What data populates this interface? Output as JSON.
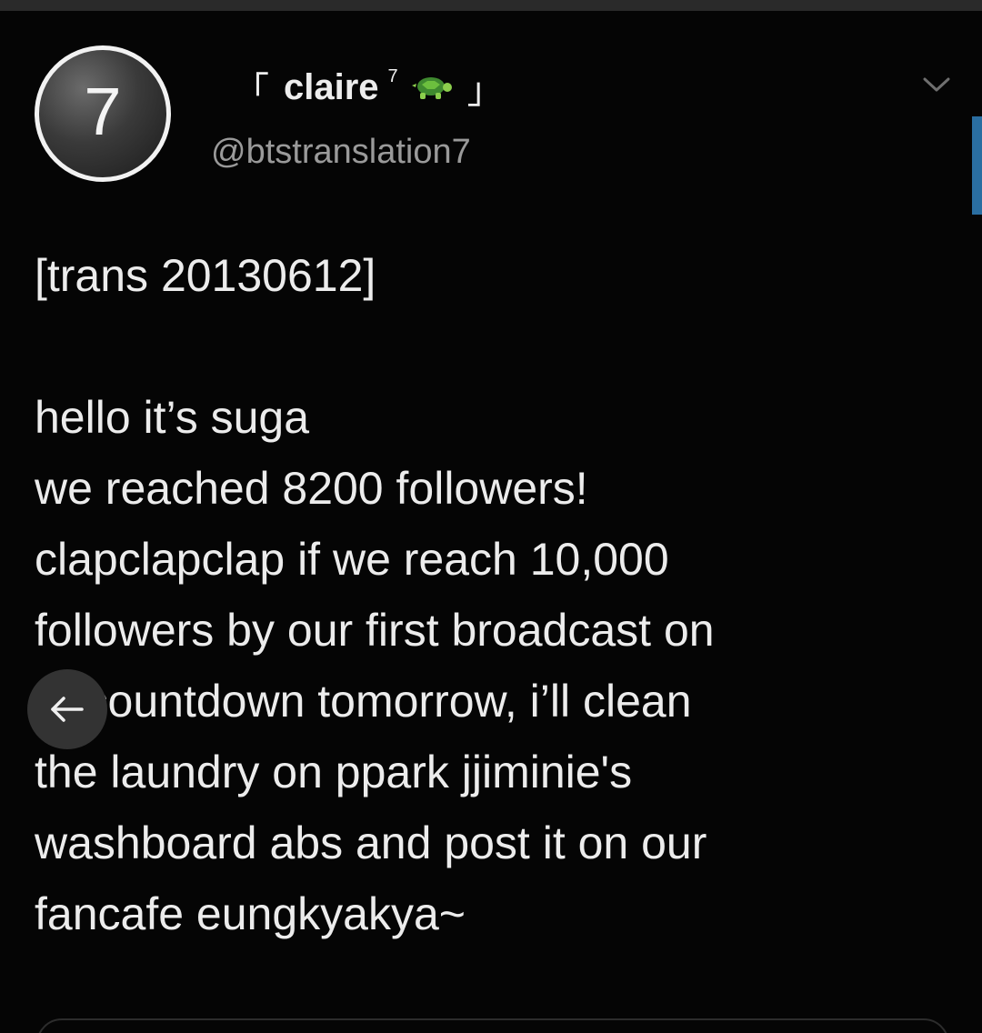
{
  "tweet": {
    "avatar_text": "7",
    "display_name": {
      "open_bracket": "「",
      "name": "claire",
      "superscript": "7",
      "close_bracket": "」"
    },
    "handle": "@btstranslation7",
    "text_lines": [
      "[trans 20130612]",
      "",
      "hello it’s suga",
      "we reached 8200 followers!",
      "clapclapclap if we reach 10,000",
      "followers by our first broadcast on",
      "m countdown tomorrow, i’ll clean",
      "the laundry on ppark jjiminie's",
      "washboard abs and post it on our",
      "fancafe eungkyakya~"
    ]
  },
  "icons": {
    "emoji": "turtle-icon",
    "menu": "chevron-down-icon",
    "navigation": "back-arrow-icon"
  },
  "colors": {
    "background": "#050505",
    "text": "#ececec",
    "handle": "#9a9a9a",
    "scrollbar": "#2a6ea1",
    "back_button": "#333333"
  }
}
